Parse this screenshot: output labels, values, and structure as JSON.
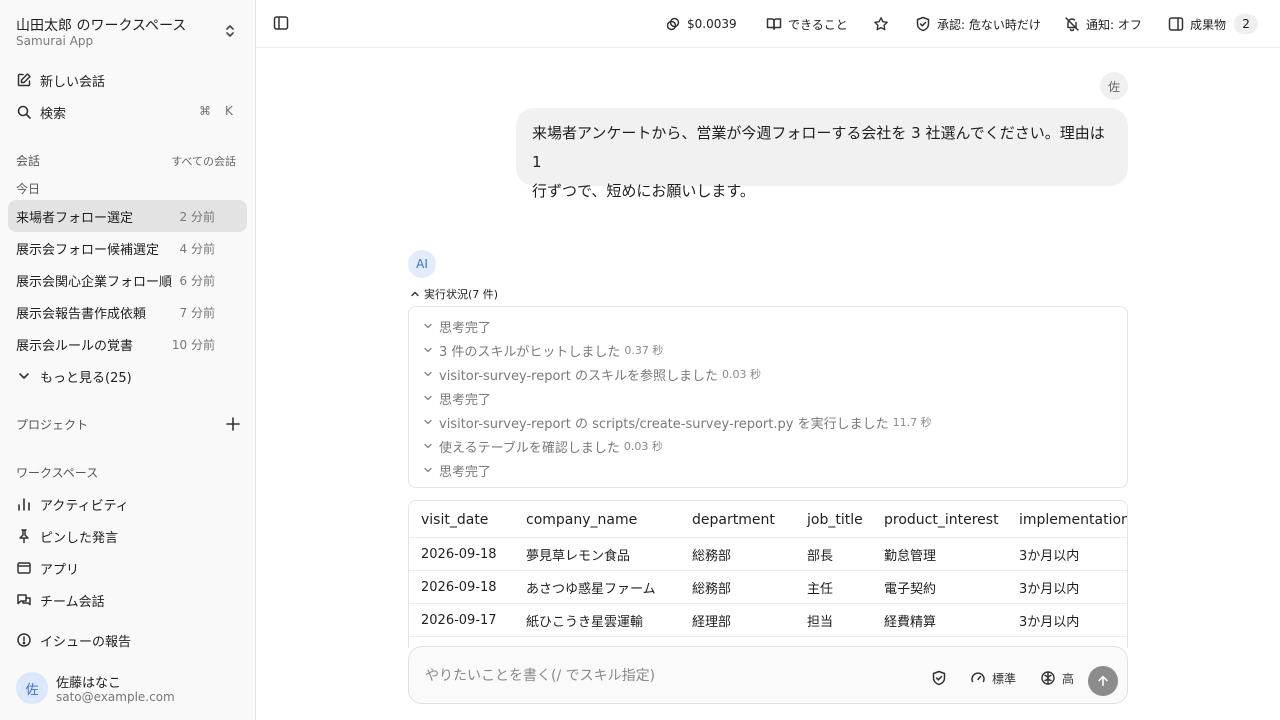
{
  "workspace": {
    "title": "山田太郎 のワークスペース",
    "subtitle": "Samurai App"
  },
  "sidebar": {
    "new_chat": "新しい会話",
    "search": "検索",
    "search_kbd_cmd": "⌘",
    "search_kbd_key": "K",
    "conversations_label": "会話",
    "all_conversations": "すべての会話",
    "today_label": "今日",
    "conversations": [
      {
        "title": "来場者フォロー選定",
        "time": "2 分前"
      },
      {
        "title": "展示会フォロー候補選定",
        "time": "4 分前"
      },
      {
        "title": "展示会関心企業フォロー順",
        "time": "6 分前"
      },
      {
        "title": "展示会報告書作成依頼",
        "time": "7 分前"
      },
      {
        "title": "展示会ルールの覚書",
        "time": "10 分前"
      }
    ],
    "more": "もっと見る(25)",
    "projects_label": "プロジェクト",
    "workspace_label": "ワークスペース",
    "workspace_items": [
      "アクティビティ",
      "ピンした発言",
      "アプリ",
      "チーム会話"
    ],
    "report_issue": "イシューの報告",
    "user": {
      "avatar": "佐",
      "name": "佐藤はなこ",
      "email": "sato@example.com"
    }
  },
  "header": {
    "cost": "$0.0039",
    "capabilities": "できること",
    "approval": "承認: 危ない時だけ",
    "notifications": "通知: オフ",
    "artifacts": "成果物",
    "artifacts_count": "2"
  },
  "chat": {
    "user_avatar": "佐",
    "user_message_line1": "来場者アンケートから、営業が今週フォローする会社を 3 社選んでください。理由は 1",
    "user_message_line2": "行ずつで、短めにお願いします。",
    "ai_avatar": "AI",
    "exec_status": "実行状況(7 件)",
    "steps": [
      {
        "text": "思考完了",
        "duration": ""
      },
      {
        "text": "3 件のスキルがヒットしました",
        "duration": "0.37 秒"
      },
      {
        "text": "visitor-survey-report のスキルを参照しました",
        "duration": "0.03 秒"
      },
      {
        "text": "思考完了",
        "duration": ""
      },
      {
        "text": "visitor-survey-report の scripts/create-survey-report.py を実行しました",
        "duration": "11.7 秒"
      },
      {
        "text": "使えるテーブルを確認しました",
        "duration": "0.03 秒"
      },
      {
        "text": "思考完了",
        "duration": ""
      }
    ],
    "table": {
      "columns": [
        "visit_date",
        "company_name",
        "department",
        "job_title",
        "product_interest",
        "implementation_"
      ],
      "rows": [
        [
          "2026-09-18",
          "夢見草レモン食品",
          "総務部",
          "部長",
          "勤怠管理",
          "3か月以内"
        ],
        [
          "2026-09-18",
          "あさつゆ惑星ファーム",
          "総務部",
          "主任",
          "電子契約",
          "3か月以内"
        ],
        [
          "2026-09-17",
          "紙ひこうき星雲運輸",
          "経理部",
          "担当",
          "経費精算",
          "3か月以内"
        ]
      ]
    }
  },
  "composer": {
    "placeholder": "やりたいことを書く(/ でスキル指定)",
    "mode": "標準",
    "level": "高"
  }
}
